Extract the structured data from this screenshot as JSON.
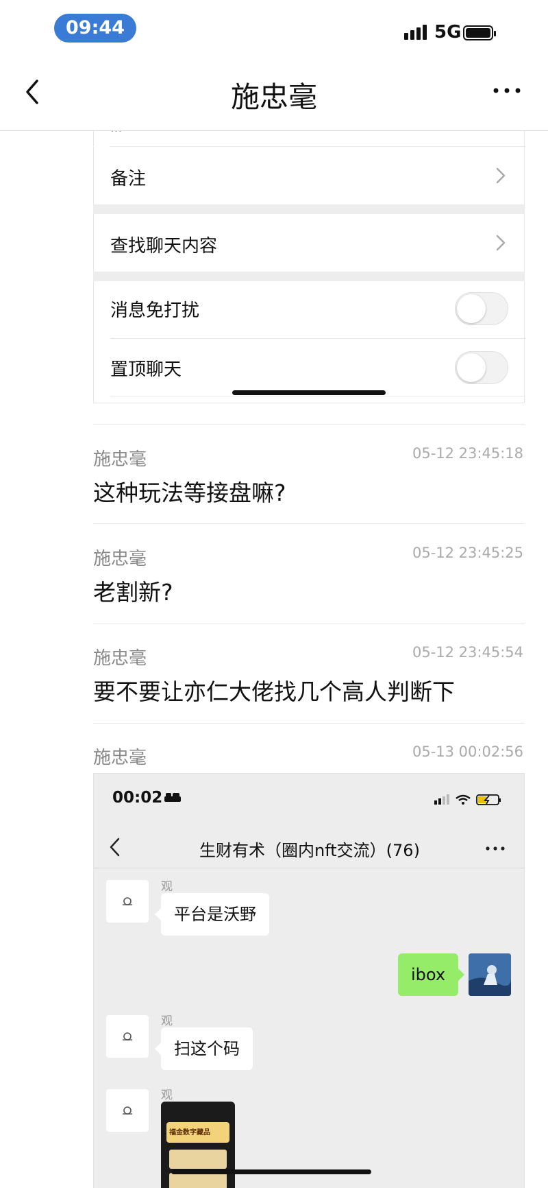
{
  "status_bar": {
    "time": "09:44",
    "network": "5G"
  },
  "nav": {
    "title": "施忠毫"
  },
  "settings": {
    "partial_top": "···",
    "remark_label": "备注",
    "search_chat_label": "查找聊天内容",
    "mute_label": "消息免打扰",
    "mute_on": false,
    "pin_label": "置顶聊天",
    "pin_on": false
  },
  "messages": [
    {
      "sender": "施忠毫",
      "timestamp": "05-12 23:45:18",
      "text": "这种玩法等接盘嘛?"
    },
    {
      "sender": "施忠毫",
      "timestamp": "05-12 23:45:25",
      "text": "老割新?"
    },
    {
      "sender": "施忠毫",
      "timestamp": "05-12 23:45:54",
      "text": "要不要让亦仁大佬找几个高人判断下"
    },
    {
      "sender": "施忠毫",
      "timestamp": "05-13 00:02:56",
      "text": ""
    }
  ],
  "screenshot": {
    "time": "00:02",
    "group_title": "生财有术（圈内nft交流）(76)",
    "chat": [
      {
        "nick": "观",
        "text": "平台是沃野",
        "side": "left"
      },
      {
        "nick": "",
        "text": "ibox",
        "side": "right"
      },
      {
        "nick": "观",
        "text": "扫这个码",
        "side": "left"
      },
      {
        "nick": "观",
        "text": "",
        "side": "left",
        "image_caption": "福金数字藏品"
      }
    ]
  },
  "colors": {
    "time_pill": "#3a7bd5",
    "bubble_green": "#95ec69",
    "chat_bg": "#ededed"
  }
}
